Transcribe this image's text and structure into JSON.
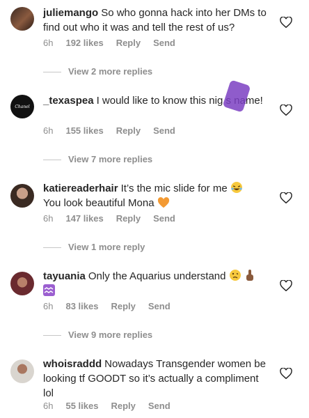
{
  "comments": [
    {
      "username": "juliemango",
      "text": "So who gonna hack into her DMs to find out who it was and tell the rest of us?",
      "time": "6h",
      "likes": "192 likes",
      "reply": "Reply",
      "send": "Send",
      "view_replies": "View 2 more replies"
    },
    {
      "username": "_texaspea",
      "text": "I would like to know this nig s name!",
      "avatar_text": "Chanel",
      "time": "6h",
      "likes": "155 likes",
      "reply": "Reply",
      "send": "Send",
      "view_replies": "View 7 more replies"
    },
    {
      "username": "katiereaderhair",
      "text_line1": "It’s the mic slide for me",
      "text_line2": "You look beautiful Mona",
      "time": "6h",
      "likes": "147 likes",
      "reply": "Reply",
      "send": "Send",
      "view_replies": "View 1 more reply"
    },
    {
      "username": "tayuania",
      "text": "Only the Aquarius understand",
      "time": "6h",
      "likes": "83 likes",
      "reply": "Reply",
      "send": "Send",
      "view_replies": "View 9 more replies"
    },
    {
      "username": "whoisraddd",
      "text": "Nowadays Transgender women be looking tf GOODT so it’s actually a compliment lol",
      "time": "6h",
      "likes": "55 likes",
      "reply": "Reply",
      "send": "Send"
    }
  ],
  "colors": {
    "text": "#262626",
    "muted": "#8e8e8e",
    "divider": "#c7c7c7"
  }
}
